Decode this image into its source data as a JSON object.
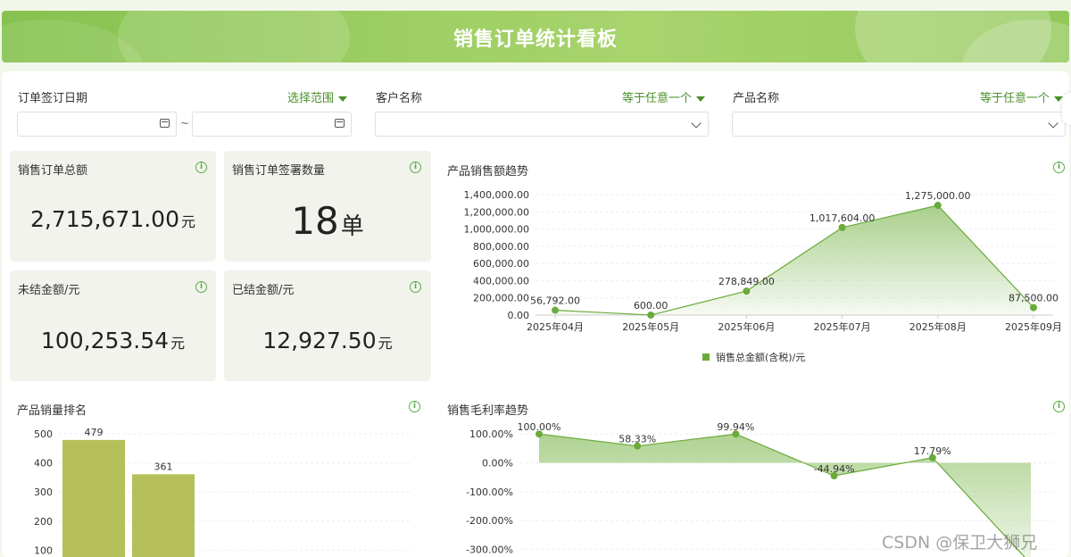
{
  "header": {
    "title": "销售订单统计看板"
  },
  "filters": {
    "date": {
      "label": "订单签订日期",
      "operator": "选择范围",
      "start_value": "",
      "end_value": "",
      "separator": "~"
    },
    "customer": {
      "label": "客户名称",
      "operator": "等于任意一个",
      "value": ""
    },
    "product": {
      "label": "产品名称",
      "operator": "等于任意一个",
      "value": ""
    }
  },
  "cards": {
    "total_amount": {
      "title": "销售订单总额",
      "value": "2,715,671.00",
      "unit": "元"
    },
    "order_count": {
      "title": "销售订单签署数量",
      "value": "18",
      "unit": "单"
    },
    "unsettled": {
      "title": "未结金额/元",
      "value": "100,253.54",
      "unit": "元"
    },
    "settled": {
      "title": "已结金额/元",
      "value": "12,927.50",
      "unit": "元"
    }
  },
  "charts": {
    "sales_trend_title": "产品销售额趋势",
    "ranking_title": "产品销量排名",
    "margin_title": "销售毛利率趋势"
  },
  "colors": {
    "accent": "#4a8f2a",
    "series": "#6aaa3a",
    "bar": "#b5c05a",
    "card_bg": "#f1f3ec"
  },
  "watermark": "CSDN @保卫大狮兄",
  "chart_data": [
    {
      "type": "area",
      "title": "产品销售额趋势",
      "x": [
        "2025年04月",
        "2025年05月",
        "2025年06月",
        "2025年07月",
        "2025年08月",
        "2025年09月"
      ],
      "series": [
        {
          "name": "销售总金额(含税)/元",
          "values": [
            56792,
            600,
            278849,
            1017604,
            1275000,
            87500
          ],
          "labels": [
            "56,792.00",
            "600.00",
            "278,849.00",
            "1,017,604.00",
            "1,275,000.00",
            "87,500.00"
          ]
        }
      ],
      "yticks": [
        "0.00",
        "200,000.00",
        "400,000.00",
        "600,000.00",
        "800,000.00",
        "1,000,000.00",
        "1,200,000.00",
        "1,400,000.00"
      ],
      "ylim": [
        0,
        1400000
      ],
      "legend": "bottom"
    },
    {
      "type": "bar",
      "title": "产品销量排名",
      "categories": [
        "",
        ""
      ],
      "values": [
        479,
        361
      ],
      "labels": [
        "479",
        "361"
      ],
      "yticks": [
        "100",
        "200",
        "300",
        "400",
        "500"
      ],
      "ylim": [
        0,
        500
      ]
    },
    {
      "type": "area",
      "title": "销售毛利率趋势",
      "series": [
        {
          "values": [
            100.0,
            58.33,
            99.94,
            -44.94,
            17.79,
            -350
          ],
          "labels": [
            "100.00%",
            "58.33%",
            "99.94%",
            "-44.94%",
            "17.79%",
            ""
          ]
        }
      ],
      "yticks": [
        "-300.00%",
        "-200.00%",
        "-100.00%",
        "0.00%",
        "100.00%"
      ],
      "ylim": [
        -300,
        100
      ]
    }
  ]
}
